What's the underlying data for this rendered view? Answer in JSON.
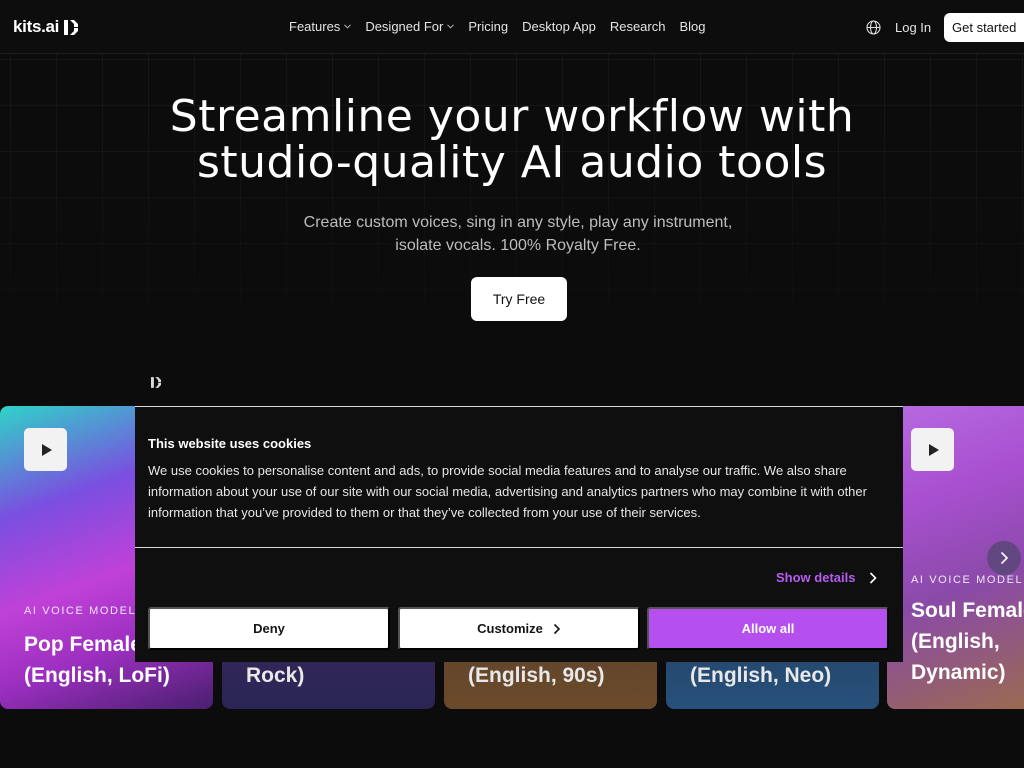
{
  "brand": {
    "name": "kits.ai"
  },
  "nav": {
    "links": [
      {
        "label": "Features",
        "dropdown": true
      },
      {
        "label": "Designed For",
        "dropdown": true
      },
      {
        "label": "Pricing",
        "dropdown": false
      },
      {
        "label": "Desktop App",
        "dropdown": false
      },
      {
        "label": "Research",
        "dropdown": false
      },
      {
        "label": "Blog",
        "dropdown": false
      }
    ],
    "login": "Log In",
    "cta": "Get started"
  },
  "hero": {
    "title_line1": "Streamline your workflow with",
    "title_line2": "studio-quality AI audio tools",
    "subtitle_line1": "Create custom voices, sing in any style, play any instrument,",
    "subtitle_line2": "isolate vocals. 100% Royalty Free.",
    "cta": "Try Free"
  },
  "cards": [
    {
      "eyebrow": "AI VOICE MODEL",
      "title_line1": "Pop Female",
      "title_line2": "(English, LoFi)"
    },
    {
      "title_line2": "Rock)"
    },
    {
      "title_line2": "(English, 90s)"
    },
    {
      "title_line2": "(English, Neo)"
    },
    {
      "eyebrow": "AI VOICE MODEL",
      "title": "Soul Female (English, Dynamic)"
    }
  ],
  "cookie": {
    "title": "This website uses cookies",
    "body": "We use cookies to personalise content and ads, to provide social media features and to analyse our traffic. We also share information about your use of our site with our social media, advertising and analytics partners who may combine it with other information that you’ve provided to them or that they’ve collected from your use of their services.",
    "show_details": "Show details",
    "deny": "Deny",
    "customize": "Customize",
    "allow_all": "Allow all"
  },
  "colors": {
    "background": "#0c0c0c",
    "accent_purple": "#b550ef",
    "link_purple": "#b65cf0"
  }
}
